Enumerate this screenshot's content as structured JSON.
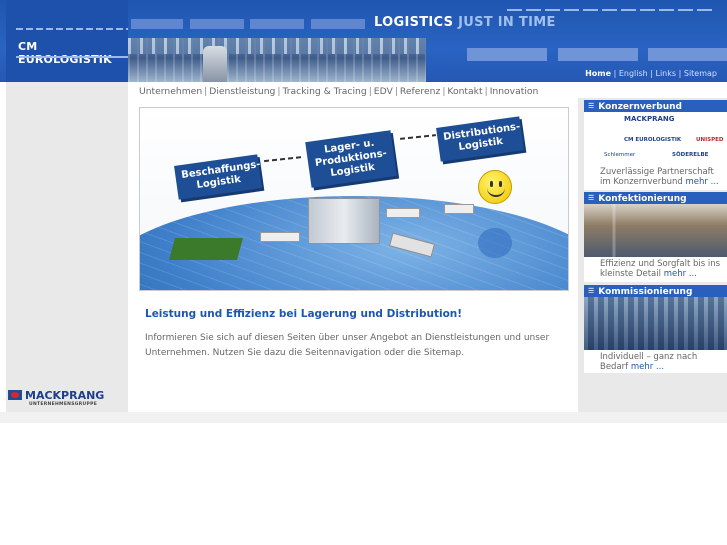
{
  "header": {
    "logo_text": "CM EUROLOGISTIK",
    "slogan_main": "LOGISTICS",
    "slogan_rest": "JUST IN TIME",
    "top_links": {
      "home": "Home",
      "english": "English",
      "links": "Links",
      "sitemap": "Sitemap"
    }
  },
  "nav": {
    "items": [
      "Unternehmen",
      "Dienstleistung",
      "Tracking & Tracing",
      "EDV",
      "Referenz",
      "Kontakt",
      "Innovation"
    ]
  },
  "hero": {
    "label_1": "Beschaffungs-Logistik",
    "label_2": "Lager- u. Produktions-Logistik",
    "label_3": "Distributions-Logistik"
  },
  "content": {
    "headline": "Leistung und Effizienz bei Lagerung und Distribution!",
    "body": "Informieren Sie sich auf diesen Seiten über unser Angebot an Dienstleistungen und unser Unternehmen. Nutzen Sie dazu die Seitennavigation oder die Sitemap."
  },
  "sidebar": {
    "panels": [
      {
        "title": "Konzernverbund",
        "text": "Zuverlässige Partnerschaft im Konzernverbund",
        "more": "mehr ..."
      },
      {
        "title": "Konfektionierung",
        "text": "Effizienz und Sorgfalt bis ins kleinste Detail",
        "more": "mehr ..."
      },
      {
        "title": "Kommissionierung",
        "text": "Individuell – ganz nach Bedarf",
        "more": "mehr ..."
      }
    ],
    "group_logos": [
      "MACKPRANG",
      "CM EUROLOGISTIK",
      "UNISPED",
      "Schlemmer",
      "SÖDERELBE"
    ]
  },
  "footer": {
    "logo": "MACKPRANG",
    "logo_sub": "UNTERNEHMENSGRUPPE"
  },
  "colors": {
    "header_blue": "#2a63c2",
    "accent_blue": "#1c56b0",
    "panel_head": "#2960bd"
  }
}
